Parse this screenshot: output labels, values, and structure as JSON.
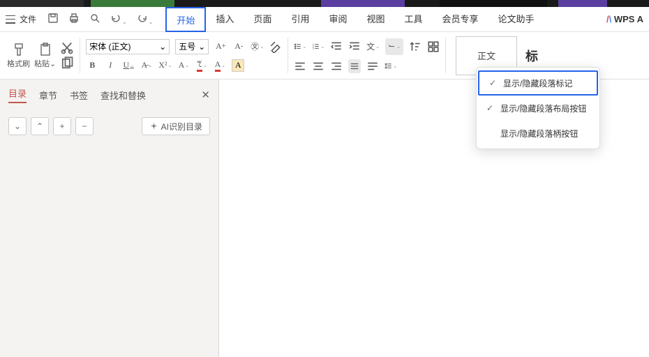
{
  "menu": {
    "file_label": "文件",
    "tabs": [
      "开始",
      "插入",
      "页面",
      "引用",
      "审阅",
      "视图",
      "工具",
      "会员专享",
      "论文助手"
    ],
    "active_tab_index": 0,
    "wps_label": "WPS A"
  },
  "ribbon": {
    "clipboard": {
      "format_brush": "格式刷",
      "paste": "粘贴"
    },
    "font": {
      "name": "宋体 (正文)",
      "size": "五号"
    },
    "char_box": "A",
    "style_normal": "正文",
    "style_title": "标"
  },
  "side": {
    "tabs": [
      "目录",
      "章节",
      "书签",
      "查找和替换"
    ],
    "active_tab_index": 0,
    "ai_button": "AI识别目录"
  },
  "dropdown": {
    "items": [
      {
        "label": "显示/隐藏段落标记",
        "checked": true,
        "highlight": true
      },
      {
        "label": "显示/隐藏段落布局按钮",
        "checked": true,
        "highlight": false
      },
      {
        "label": "显示/隐藏段落柄按钮",
        "checked": false,
        "highlight": false
      }
    ]
  },
  "icons": {
    "chevron_down": "⌄",
    "check": "✓",
    "close": "✕",
    "plus": "+",
    "minus": "−"
  }
}
